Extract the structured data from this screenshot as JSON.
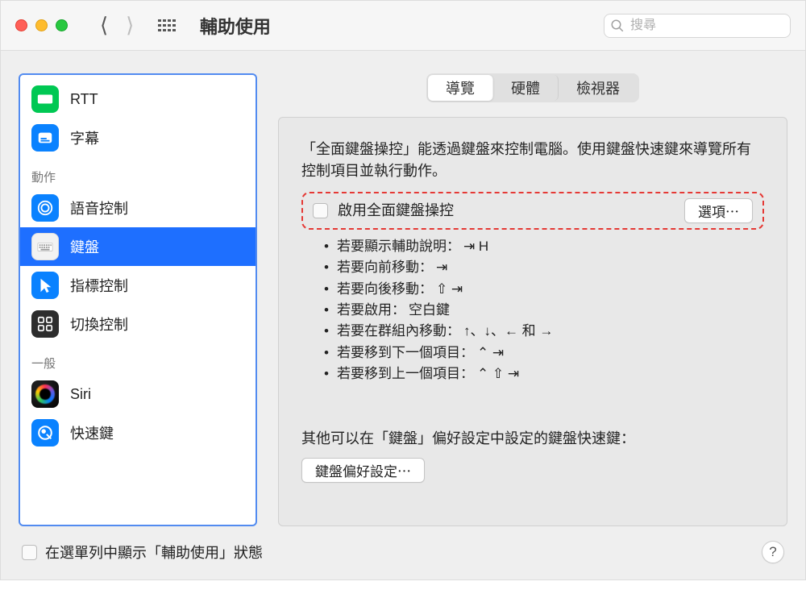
{
  "window": {
    "title": "輔助使用"
  },
  "search": {
    "placeholder": "搜尋"
  },
  "sidebar": {
    "sections": {
      "actions": "動作",
      "general": "一般"
    },
    "items": {
      "rtt": "RTT",
      "subtitles": "字幕",
      "voiceControl": "語音控制",
      "keyboard": "鍵盤",
      "pointerControl": "指標控制",
      "switchControl": "切換控制",
      "siri": "Siri",
      "shortcut": "快速鍵"
    },
    "selected": "keyboard"
  },
  "tabs": {
    "navigate": "導覽",
    "hardware": "硬體",
    "viewer": "檢視器"
  },
  "pane": {
    "intro": "「全面鍵盤操控」能透過鍵盤來控制電腦。使用鍵盤快速鍵來導覽所有控制項目並執行動作。",
    "enableLabel": "啟用全面鍵盤操控",
    "optionsButton": "選項⋯",
    "bullets": {
      "b1_text": "若要顯示輔助說明：",
      "b1_keys": "⇥ H",
      "b2_text": "若要向前移動：",
      "b2_keys": "⇥",
      "b3_text": "若要向後移動：",
      "b3_keys": "⇧ ⇥",
      "b4_text": "若要啟用：",
      "b4_keys": "空白鍵",
      "b5_text": "若要在群組內移動：",
      "b5_keys": "↑、↓、← 和 →",
      "b6_text": "若要移到下一個項目：",
      "b6_keys": "⌃ ⇥",
      "b7_text": "若要移到上一個項目：",
      "b7_keys": "⌃ ⇧ ⇥"
    },
    "otherLabel": "其他可以在「鍵盤」偏好設定中設定的鍵盤快速鍵：",
    "prefsButton": "鍵盤偏好設定⋯"
  },
  "footer": {
    "checkboxLabel": "在選單列中顯示「輔助使用」狀態"
  }
}
